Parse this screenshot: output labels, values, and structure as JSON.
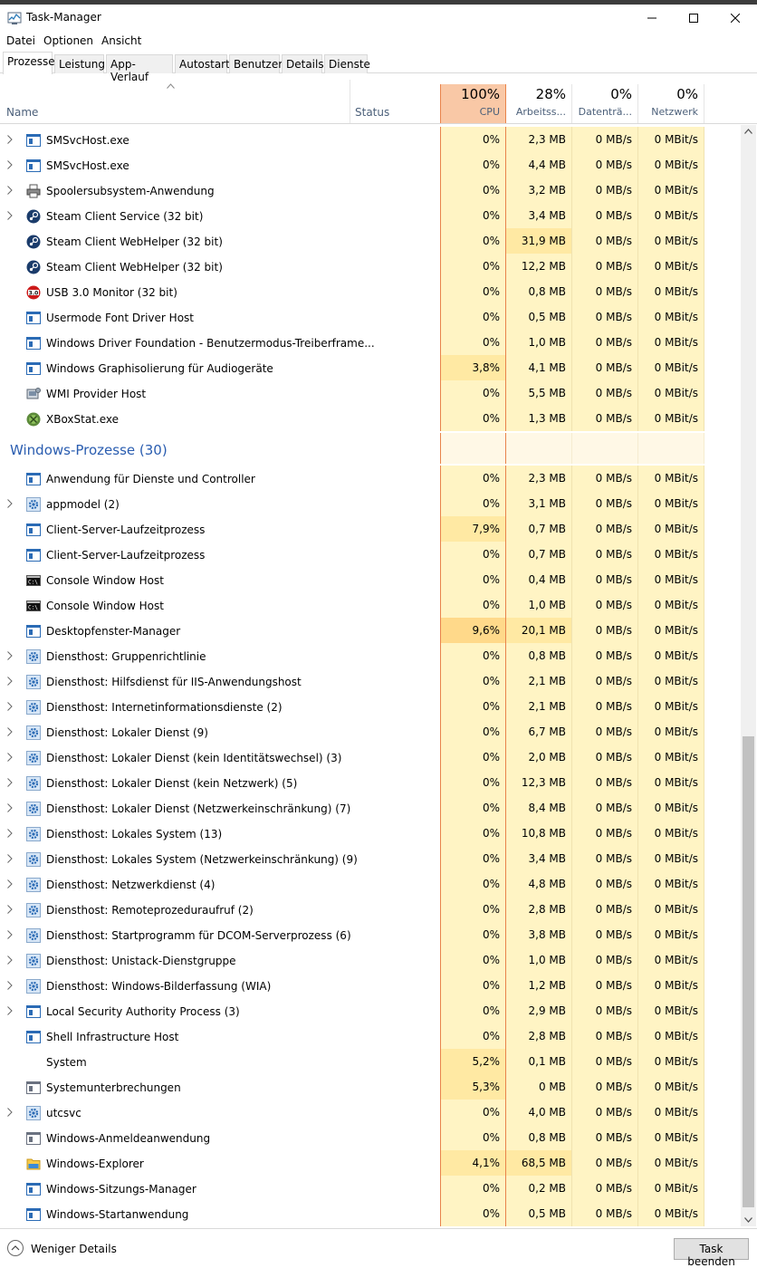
{
  "window": {
    "title": "Task-Manager"
  },
  "menu": [
    "Datei",
    "Optionen",
    "Ansicht"
  ],
  "tabs": [
    "Prozesse",
    "Leistung",
    "App-Verlauf",
    "Autostart",
    "Benutzer",
    "Details",
    "Dienste"
  ],
  "header": {
    "name": "Name",
    "status": "Status",
    "cpu": {
      "pct": "100%",
      "label": "CPU"
    },
    "mem": {
      "pct": "28%",
      "label": "Arbeitss..."
    },
    "disk": {
      "pct": "0%",
      "label": "Datenträ..."
    },
    "net": {
      "pct": "0%",
      "label": "Netzwerk"
    }
  },
  "processes_top": [
    {
      "name": "SMSvcHost.exe",
      "icon": "app-window-icon",
      "expand": true,
      "cpu": "0%",
      "mem": "2,3 MB",
      "disk": "0 MB/s",
      "net": "0 MBit/s"
    },
    {
      "name": "SMSvcHost.exe",
      "icon": "app-window-icon",
      "expand": true,
      "cpu": "0%",
      "mem": "4,4 MB",
      "disk": "0 MB/s",
      "net": "0 MBit/s"
    },
    {
      "name": "Spoolersubsystem-Anwendung",
      "icon": "printer-icon",
      "expand": true,
      "cpu": "0%",
      "mem": "3,2 MB",
      "disk": "0 MB/s",
      "net": "0 MBit/s"
    },
    {
      "name": "Steam Client Service (32 bit)",
      "icon": "steam-icon",
      "expand": true,
      "cpu": "0%",
      "mem": "3,4 MB",
      "disk": "0 MB/s",
      "net": "0 MBit/s"
    },
    {
      "name": "Steam Client WebHelper (32 bit)",
      "icon": "steam-icon",
      "expand": false,
      "cpu": "0%",
      "mem": "31,9 MB",
      "disk": "0 MB/s",
      "net": "0 MBit/s"
    },
    {
      "name": "Steam Client WebHelper (32 bit)",
      "icon": "steam-icon",
      "expand": false,
      "cpu": "0%",
      "mem": "12,2 MB",
      "disk": "0 MB/s",
      "net": "0 MBit/s"
    },
    {
      "name": "USB 3.0 Monitor (32 bit)",
      "icon": "usb-monitor-icon",
      "expand": false,
      "cpu": "0%",
      "mem": "0,8 MB",
      "disk": "0 MB/s",
      "net": "0 MBit/s"
    },
    {
      "name": "Usermode Font Driver Host",
      "icon": "app-window-icon",
      "expand": false,
      "cpu": "0%",
      "mem": "0,5 MB",
      "disk": "0 MB/s",
      "net": "0 MBit/s"
    },
    {
      "name": "Windows Driver Foundation - Benutzermodus-Treiberframe...",
      "icon": "app-window-icon",
      "expand": false,
      "cpu": "0%",
      "mem": "1,0 MB",
      "disk": "0 MB/s",
      "net": "0 MBit/s"
    },
    {
      "name": "Windows Graphisolierung für Audiogeräte",
      "icon": "app-window-icon",
      "expand": false,
      "cpu": "3,8%",
      "mem": "4,1 MB",
      "disk": "0 MB/s",
      "net": "0 MBit/s"
    },
    {
      "name": "WMI Provider Host",
      "icon": "wmi-icon",
      "expand": false,
      "cpu": "0%",
      "mem": "5,5 MB",
      "disk": "0 MB/s",
      "net": "0 MBit/s"
    },
    {
      "name": "XBoxStat.exe",
      "icon": "xbox-icon",
      "expand": false,
      "cpu": "0%",
      "mem": "1,3 MB",
      "disk": "0 MB/s",
      "net": "0 MBit/s"
    }
  ],
  "group_label": "Windows-Prozesse (30)",
  "processes_windows": [
    {
      "name": "Anwendung für Dienste und Controller",
      "icon": "app-window-icon",
      "expand": false,
      "cpu": "0%",
      "mem": "2,3 MB",
      "disk": "0 MB/s",
      "net": "0 MBit/s"
    },
    {
      "name": "appmodel (2)",
      "icon": "gear-icon",
      "expand": true,
      "cpu": "0%",
      "mem": "3,1 MB",
      "disk": "0 MB/s",
      "net": "0 MBit/s"
    },
    {
      "name": "Client-Server-Laufzeitprozess",
      "icon": "app-window-icon",
      "expand": false,
      "cpu": "7,9%",
      "mem": "0,7 MB",
      "disk": "0 MB/s",
      "net": "0 MBit/s"
    },
    {
      "name": "Client-Server-Laufzeitprozess",
      "icon": "app-window-icon",
      "expand": false,
      "cpu": "0%",
      "mem": "0,7 MB",
      "disk": "0 MB/s",
      "net": "0 MBit/s"
    },
    {
      "name": "Console Window Host",
      "icon": "console-icon",
      "expand": false,
      "cpu": "0%",
      "mem": "0,4 MB",
      "disk": "0 MB/s",
      "net": "0 MBit/s"
    },
    {
      "name": "Console Window Host",
      "icon": "console-icon",
      "expand": false,
      "cpu": "0%",
      "mem": "1,0 MB",
      "disk": "0 MB/s",
      "net": "0 MBit/s"
    },
    {
      "name": "Desktopfenster-Manager",
      "icon": "app-window-icon",
      "expand": false,
      "cpu": "9,6%",
      "mem": "20,1 MB",
      "disk": "0 MB/s",
      "net": "0 MBit/s"
    },
    {
      "name": "Diensthost: Gruppenrichtlinie",
      "icon": "gear-icon",
      "expand": true,
      "cpu": "0%",
      "mem": "0,8 MB",
      "disk": "0 MB/s",
      "net": "0 MBit/s"
    },
    {
      "name": "Diensthost: Hilfsdienst für IIS-Anwendungshost",
      "icon": "gear-icon",
      "expand": true,
      "cpu": "0%",
      "mem": "2,1 MB",
      "disk": "0 MB/s",
      "net": "0 MBit/s"
    },
    {
      "name": "Diensthost: Internetinformationsdienste (2)",
      "icon": "gear-icon",
      "expand": true,
      "cpu": "0%",
      "mem": "2,1 MB",
      "disk": "0 MB/s",
      "net": "0 MBit/s"
    },
    {
      "name": "Diensthost: Lokaler Dienst (9)",
      "icon": "gear-icon",
      "expand": true,
      "cpu": "0%",
      "mem": "6,7 MB",
      "disk": "0 MB/s",
      "net": "0 MBit/s"
    },
    {
      "name": "Diensthost: Lokaler Dienst (kein Identitätswechsel) (3)",
      "icon": "gear-icon",
      "expand": true,
      "cpu": "0%",
      "mem": "2,0 MB",
      "disk": "0 MB/s",
      "net": "0 MBit/s"
    },
    {
      "name": "Diensthost: Lokaler Dienst (kein Netzwerk) (5)",
      "icon": "gear-icon",
      "expand": true,
      "cpu": "0%",
      "mem": "12,3 MB",
      "disk": "0 MB/s",
      "net": "0 MBit/s"
    },
    {
      "name": "Diensthost: Lokaler Dienst (Netzwerkeinschränkung) (7)",
      "icon": "gear-icon",
      "expand": true,
      "cpu": "0%",
      "mem": "8,4 MB",
      "disk": "0 MB/s",
      "net": "0 MBit/s"
    },
    {
      "name": "Diensthost: Lokales System (13)",
      "icon": "gear-icon",
      "expand": true,
      "cpu": "0%",
      "mem": "10,8 MB",
      "disk": "0 MB/s",
      "net": "0 MBit/s"
    },
    {
      "name": "Diensthost: Lokales System (Netzwerkeinschränkung) (9)",
      "icon": "gear-icon",
      "expand": true,
      "cpu": "0%",
      "mem": "3,4 MB",
      "disk": "0 MB/s",
      "net": "0 MBit/s"
    },
    {
      "name": "Diensthost: Netzwerkdienst (4)",
      "icon": "gear-icon",
      "expand": true,
      "cpu": "0%",
      "mem": "4,8 MB",
      "disk": "0 MB/s",
      "net": "0 MBit/s"
    },
    {
      "name": "Diensthost: Remoteprozeduraufruf (2)",
      "icon": "gear-icon",
      "expand": true,
      "cpu": "0%",
      "mem": "2,8 MB",
      "disk": "0 MB/s",
      "net": "0 MBit/s"
    },
    {
      "name": "Diensthost: Startprogramm für DCOM-Serverprozess (6)",
      "icon": "gear-icon",
      "expand": true,
      "cpu": "0%",
      "mem": "3,8 MB",
      "disk": "0 MB/s",
      "net": "0 MBit/s"
    },
    {
      "name": "Diensthost: Unistack-Dienstgruppe",
      "icon": "gear-icon",
      "expand": true,
      "cpu": "0%",
      "mem": "1,0 MB",
      "disk": "0 MB/s",
      "net": "0 MBit/s"
    },
    {
      "name": "Diensthost: Windows-Bilderfassung (WIA)",
      "icon": "gear-icon",
      "expand": true,
      "cpu": "0%",
      "mem": "1,2 MB",
      "disk": "0 MB/s",
      "net": "0 MBit/s"
    },
    {
      "name": "Local Security Authority Process (3)",
      "icon": "app-window-icon",
      "expand": true,
      "cpu": "0%",
      "mem": "2,9 MB",
      "disk": "0 MB/s",
      "net": "0 MBit/s"
    },
    {
      "name": "Shell Infrastructure Host",
      "icon": "app-window-icon",
      "expand": false,
      "cpu": "0%",
      "mem": "2,8 MB",
      "disk": "0 MB/s",
      "net": "0 MBit/s"
    },
    {
      "name": "System",
      "icon": "blank-icon",
      "expand": false,
      "cpu": "5,2%",
      "mem": "0,1 MB",
      "disk": "0 MB/s",
      "net": "0 MBit/s"
    },
    {
      "name": "Systemunterbrechungen",
      "icon": "app-window-gray-icon",
      "expand": false,
      "cpu": "5,3%",
      "mem": "0 MB",
      "disk": "0 MB/s",
      "net": "0 MBit/s"
    },
    {
      "name": "utcsvc",
      "icon": "gear-icon",
      "expand": true,
      "cpu": "0%",
      "mem": "4,0 MB",
      "disk": "0 MB/s",
      "net": "0 MBit/s"
    },
    {
      "name": "Windows-Anmeldeanwendung",
      "icon": "app-window-gray-icon",
      "expand": false,
      "cpu": "0%",
      "mem": "0,8 MB",
      "disk": "0 MB/s",
      "net": "0 MBit/s"
    },
    {
      "name": "Windows-Explorer",
      "icon": "folder-icon",
      "expand": false,
      "cpu": "4,1%",
      "mem": "68,5 MB",
      "disk": "0 MB/s",
      "net": "0 MBit/s"
    },
    {
      "name": "Windows-Sitzungs-Manager",
      "icon": "app-window-icon",
      "expand": false,
      "cpu": "0%",
      "mem": "0,2 MB",
      "disk": "0 MB/s",
      "net": "0 MBit/s"
    },
    {
      "name": "Windows-Startanwendung",
      "icon": "app-window-icon",
      "expand": false,
      "cpu": "0%",
      "mem": "0,5 MB",
      "disk": "0 MB/s",
      "net": "0 MBit/s"
    }
  ],
  "footer": {
    "less_details": "Weniger Details",
    "end_task": "Task beenden"
  },
  "colors": {
    "cpu_header": "#f9c8a6",
    "cell_light": "#fff4c4",
    "cell_mid": "#ffe9a3",
    "cell_high": "#ffd98a",
    "group": "#2a5db0"
  }
}
